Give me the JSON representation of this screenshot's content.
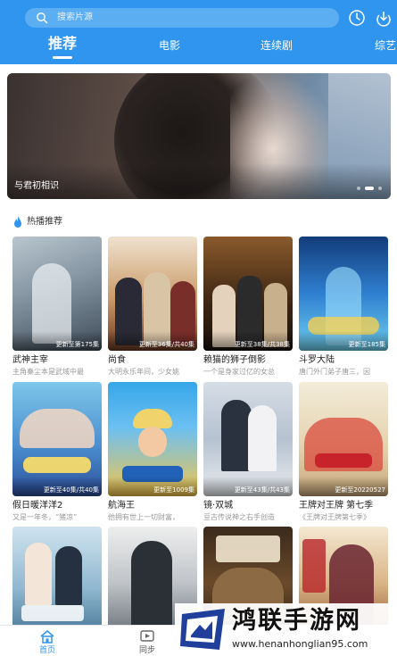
{
  "search": {
    "placeholder": "搜索片源",
    "icon": "search-icon"
  },
  "header_actions": [
    {
      "name": "history-icon"
    },
    {
      "name": "download-icon"
    }
  ],
  "tabs": [
    {
      "label": "推荐",
      "active": true
    },
    {
      "label": "电影",
      "active": false
    },
    {
      "label": "连续剧",
      "active": false
    },
    {
      "label": "综艺",
      "active": false
    }
  ],
  "banner": {
    "title": "与君初相识",
    "page_count": 3,
    "current_page": 2
  },
  "section": {
    "title": "热播推荐",
    "icon": "fire-icon"
  },
  "cards": [
    {
      "title": "武神主宰",
      "desc": "主角秦尘本是武域中最",
      "badge": "更新至第175集"
    },
    {
      "title": "尚食",
      "desc": "大明永乐年间，少女姚",
      "badge": "更新至36集/共40集"
    },
    {
      "title": "赖猫的狮子倒影",
      "desc": "一个是身家过亿的女总",
      "badge": "更新至38集/共38集"
    },
    {
      "title": "斗罗大陆",
      "desc": "唐门外门弟子唐三，因",
      "badge": "更新至185集"
    },
    {
      "title": "假日暖洋洋2",
      "desc": "又是一年冬，“猪凉”",
      "badge": "更新至40集/共40集"
    },
    {
      "title": "航海王",
      "desc": "他拥有世上一切财富，",
      "badge": "更新至1009集"
    },
    {
      "title": "镜·双城",
      "desc": "亘古传说神之右手创造",
      "badge": "更新至43集/共43集"
    },
    {
      "title": "王牌对王牌 第七季",
      "desc": "《王牌对王牌第七季》",
      "badge": "更新至20220527"
    },
    {
      "title": "",
      "desc": "",
      "badge": ""
    },
    {
      "title": "",
      "desc": "",
      "badge": ""
    },
    {
      "title": "",
      "desc": "",
      "badge": ""
    },
    {
      "title": "",
      "desc": "",
      "badge": ""
    }
  ],
  "bottom_nav": [
    {
      "label": "首页",
      "icon": "home-icon",
      "active": true
    },
    {
      "label": "同步",
      "icon": "sync-icon",
      "active": false
    }
  ],
  "watermark": {
    "text": "鸿联手游网",
    "url": "www.henanhonglian95.com"
  },
  "colors": {
    "accent": "#2f95ee"
  }
}
